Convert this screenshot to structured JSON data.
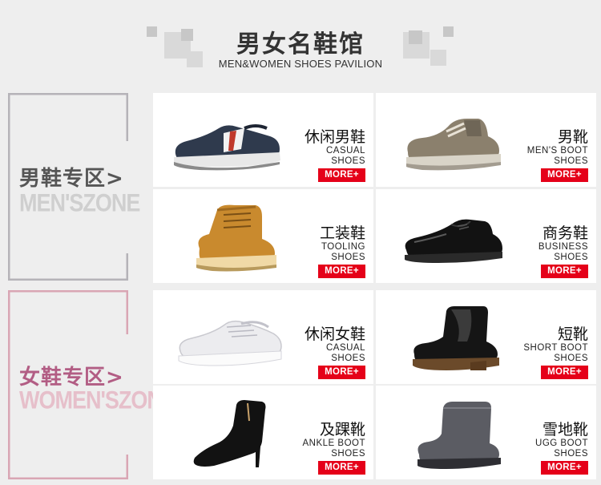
{
  "header": {
    "title_cn": "男女名鞋馆",
    "title_en": "MEN&WOMEN SHOES PAVILION"
  },
  "zones": {
    "men": {
      "label_cn": "男鞋专区>",
      "label_en": "MEN'SZONE",
      "color": "#b5b3b8",
      "en_color": "#cfcfcf",
      "cn_color": "#555555"
    },
    "women": {
      "label_cn": "女鞋专区>",
      "label_en": "WOMEN'SZONE",
      "color": "#d9a6b4",
      "en_color": "#e6bfca",
      "cn_color": "#b25d84"
    }
  },
  "cards": [
    {
      "cn": "休闲男鞋",
      "en1": "CASUAL",
      "en2": "SHOES",
      "more": "MORE+",
      "icon": "casual-men-sneaker-icon"
    },
    {
      "cn": "男靴",
      "en1": "MEN'S BOOT",
      "en2": "SHOES",
      "more": "MORE+",
      "icon": "men-boot-icon"
    },
    {
      "cn": "工装鞋",
      "en1": "TOOLING",
      "en2": "SHOES",
      "more": "MORE+",
      "icon": "tooling-boot-icon"
    },
    {
      "cn": "商务鞋",
      "en1": "BUSINESS",
      "en2": "SHOES",
      "more": "MORE+",
      "icon": "business-shoe-icon"
    },
    {
      "cn": "休闲女鞋",
      "en1": "CASUAL",
      "en2": "SHOES",
      "more": "MORE+",
      "icon": "casual-women-sneaker-icon"
    },
    {
      "cn": "短靴",
      "en1": "SHORT BOOT",
      "en2": "SHOES",
      "more": "MORE+",
      "icon": "short-boot-icon"
    },
    {
      "cn": "及踝靴",
      "en1": "ANKLE BOOT",
      "en2": "SHOES",
      "more": "MORE+",
      "icon": "ankle-boot-icon"
    },
    {
      "cn": "雪地靴",
      "en1": "UGG BOOT",
      "en2": "SHOES",
      "more": "MORE+",
      "icon": "ugg-boot-icon"
    }
  ],
  "colors": {
    "accent": "#e50019",
    "card_bg": "#ffffff",
    "page_bg": "#eeeeee"
  }
}
